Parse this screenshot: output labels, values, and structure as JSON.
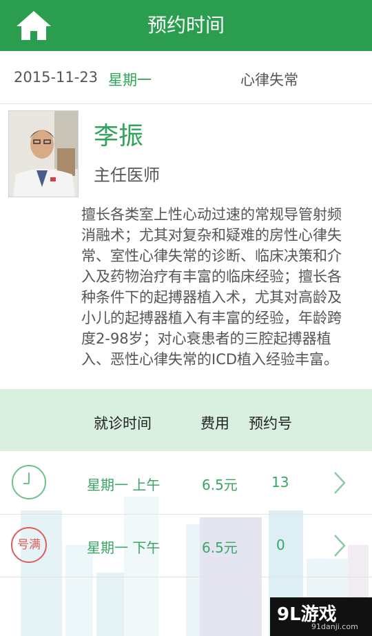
{
  "header": {
    "title": "预约时间"
  },
  "info": {
    "date": "2015-11-23",
    "weekday": "星期一",
    "department": "心律失常"
  },
  "doctor": {
    "name": "李振",
    "title": "主任医师",
    "description": "擅长各类室上性心动过速的常规导管射频消融术；尤其对复杂和疑难的房性心律失常、室性心律失常的诊断、临床决策和介入及药物治疗有丰富的临床经验；擅长各种条件下的起搏器植入术，尤其对高龄及小儿的起搏器植入有丰富的经验，年龄跨度2-98岁；对心衰患者的三腔起搏器植入、恶性心律失常的ICD植入经验丰富。"
  },
  "table": {
    "headers": [
      "就诊时间",
      "费用",
      "预约号"
    ],
    "rows": [
      {
        "time": "星期一 上午",
        "fee": "6.5元",
        "number": "13",
        "status": "available",
        "icon": "clock-icon"
      },
      {
        "time": "星期一 下午",
        "fee": "6.5元",
        "number": "0",
        "status": "full",
        "badge": "号满",
        "icon": "full-stamp-icon"
      }
    ]
  },
  "watermark": {
    "logo": "9L游戏",
    "url": "91danji.com"
  },
  "colors": {
    "primary": "#2a9d4f",
    "accent_text": "#2fa35a",
    "full_red": "#e05a5a",
    "table_header_bg": "#d9efe0"
  }
}
